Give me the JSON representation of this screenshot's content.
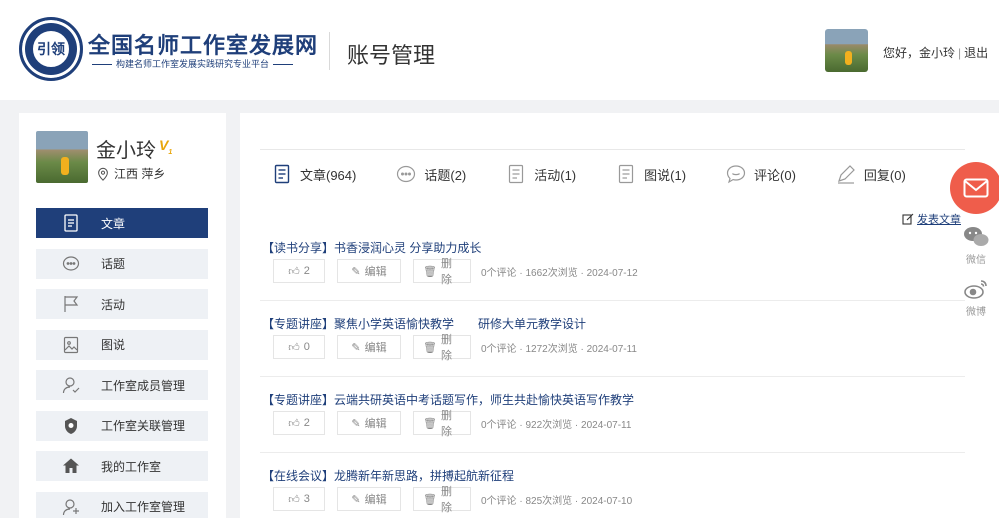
{
  "header": {
    "brand_title": "全国名师工作室发展网",
    "brand_subtitle": "构建名师工作室发展实践研究专业平台",
    "logo_text": "引领",
    "page_title": "账号管理",
    "greeting": "您好，金小玲",
    "separator": "|",
    "logout": "退出"
  },
  "profile": {
    "name": "金小玲",
    "badge": "V",
    "location": "江西 萍乡"
  },
  "menu": [
    {
      "label": "文章",
      "icon": "article-icon",
      "active": true
    },
    {
      "label": "话题",
      "icon": "chat-bubble-icon",
      "active": false
    },
    {
      "label": "活动",
      "icon": "flag-icon",
      "active": false
    },
    {
      "label": "图说",
      "icon": "image-icon",
      "active": false
    },
    {
      "label": "工作室成员管理",
      "icon": "member-icon",
      "active": false
    },
    {
      "label": "工作室关联管理",
      "icon": "shield-icon",
      "active": false
    },
    {
      "label": "我的工作室",
      "icon": "home-icon",
      "active": false
    },
    {
      "label": "加入工作室管理",
      "icon": "add-member-icon",
      "active": false
    }
  ],
  "tabs": [
    {
      "label": "文章(964)",
      "icon": "article-icon"
    },
    {
      "label": "话题(2)",
      "icon": "chat-bubble-icon"
    },
    {
      "label": "活动(1)",
      "icon": "activity-icon"
    },
    {
      "label": "图说(1)",
      "icon": "picture-doc-icon"
    },
    {
      "label": "评论(0)",
      "icon": "comment-icon"
    },
    {
      "label": "回复(0)",
      "icon": "pen-icon"
    }
  ],
  "publish_label": "发表文章",
  "share": {
    "wechat": "微信",
    "weibo": "微博"
  },
  "article_buttons": {
    "edit": "编辑",
    "delete": "删除"
  },
  "articles": [
    {
      "title": "【读书分享】书香浸润心灵 分享助力成长",
      "likes": "2",
      "meta": "0个评论 · 1662次浏览 · 2024-07-12"
    },
    {
      "title": "【专题讲座】聚焦小学英语愉快教学　　研修大单元教学设计",
      "likes": "0",
      "meta": "0个评论 · 1272次浏览 · 2024-07-11"
    },
    {
      "title": "【专题讲座】云端共研英语中考话题写作，师生共赴愉快英语写作教学",
      "likes": "2",
      "meta": "0个评论 · 922次浏览 · 2024-07-11"
    },
    {
      "title": "【在线会议】龙腾新年新思路，拼搏起航新征程",
      "likes": "3",
      "meta": "0个评论 · 825次浏览 · 2024-07-10"
    }
  ],
  "colors": {
    "brand": "#1f3f7a",
    "accent_red": "#ef5d4b",
    "badge_gold": "#e8a60a"
  }
}
